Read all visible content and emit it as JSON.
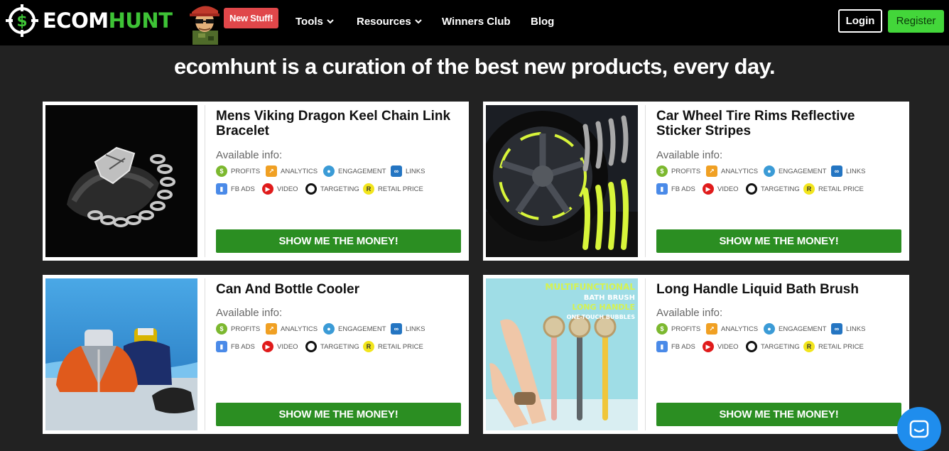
{
  "header": {
    "logo_word_white": "ECOM",
    "logo_word_green": "HUNT",
    "new_stuff": "New Stuff!",
    "nav": [
      {
        "label": "Tools",
        "has_dropdown": true
      },
      {
        "label": "Resources",
        "has_dropdown": true
      },
      {
        "label": "Winners Club",
        "has_dropdown": false
      },
      {
        "label": "Blog",
        "has_dropdown": false
      }
    ],
    "login": "Login",
    "register": "Register"
  },
  "tagline": "ecomhunt is a curation of the best new products, every day.",
  "common": {
    "available_info": "Available info:",
    "cta": "SHOW ME THE MONEY!",
    "badges": [
      {
        "label": "PROFITS",
        "icon": "dollar-icon",
        "color": "#7cb82f"
      },
      {
        "label": "ANALYTICS",
        "icon": "chart-icon",
        "color": "#f0a023"
      },
      {
        "label": "ENGAGEMENT",
        "icon": "user-icon",
        "color": "#3b9bd6"
      },
      {
        "label": "LINKS",
        "icon": "link-icon",
        "color": "#2475c2"
      },
      {
        "label": "FB ADS",
        "icon": "fb-ads-icon",
        "color": "#4a8ae8"
      },
      {
        "label": "VIDEO",
        "icon": "video-icon",
        "color": "#e01b1b"
      },
      {
        "label": "TARGETING",
        "icon": "target-icon",
        "color": "#111111"
      },
      {
        "label": "RETAIL PRICE",
        "icon": "retail-price-icon",
        "color": "#f2e51c"
      }
    ]
  },
  "products": [
    {
      "title": "Mens Viking Dragon Keel Chain Link Bracelet"
    },
    {
      "title": "Car Wheel Tire Rims Reflective Sticker Stripes"
    },
    {
      "title": "Can And Bottle Cooler"
    },
    {
      "title": "Long Handle Liquid Bath Brush",
      "image_text": [
        "MULTIFUNCTIONAL",
        "BATH BRUSH",
        "LONG HANDLE",
        "ONE-TOUCH BUBBLES"
      ]
    }
  ],
  "colors": {
    "brand_green": "#3ec336",
    "cta_green": "#2b8e22",
    "register_green": "#43d63a",
    "new_stuff_red": "#e0474a",
    "chat_blue": "#1f8ded"
  }
}
